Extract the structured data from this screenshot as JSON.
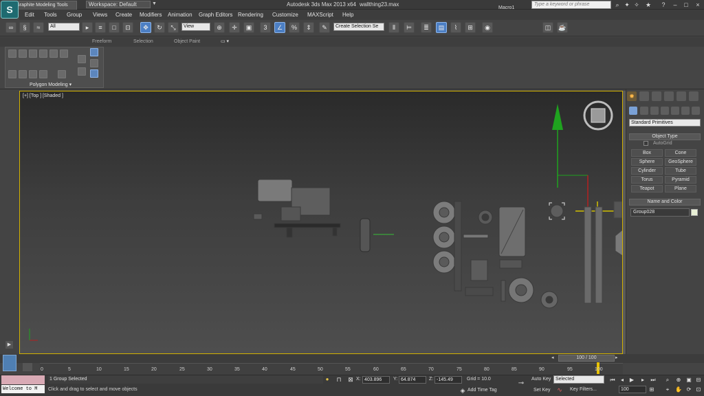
{
  "app": {
    "logo_letter": "S",
    "workspace": "Workspace: Default",
    "title": "Autodesk 3ds Max  2013 x64",
    "file": "wallthing23.max",
    "search_placeholder": "Type a keyword or phrase"
  },
  "menu": [
    "Edit",
    "Tools",
    "Group",
    "Views",
    "Create",
    "Modifiers",
    "Animation",
    "Graph Editors",
    "Rendering",
    "Customize",
    "MAXScript",
    "Help"
  ],
  "toolbar": {
    "selection_filter": "All",
    "ref_coord": "View",
    "named_selection": "Create Selection Se",
    "macro": "Macro1"
  },
  "ribbon": {
    "active_tab": "Graphite Modeling Tools",
    "tabs": [
      "Freeform",
      "Selection",
      "Object Paint"
    ],
    "panel_label": "Polygon Modeling ▾"
  },
  "viewport": {
    "label": "[+] [Top ] [Shaded ]"
  },
  "command_panel": {
    "category": "Standard Primitives",
    "object_type_title": "Object Type",
    "autogrid": "AutoGrid",
    "primitives": [
      "Box",
      "Cone",
      "Sphere",
      "GeoSphere",
      "Cylinder",
      "Tube",
      "Torus",
      "Pyramid",
      "Teapot",
      "Plane"
    ],
    "name_color_title": "Name and Color",
    "object_name": "Group028",
    "object_color": "#e9f0d6"
  },
  "timeline": {
    "slider": "100 / 100",
    "ticks": [
      "0",
      "5",
      "10",
      "15",
      "20",
      "25",
      "30",
      "35",
      "40",
      "45",
      "50",
      "55",
      "60",
      "65",
      "70",
      "75",
      "80",
      "85",
      "90",
      "95",
      "100"
    ],
    "current_frame": 100
  },
  "status": {
    "maxscript_text": "Welcome to M",
    "selection": "1 Group Selected",
    "prompt": "Click and drag to select and move objects",
    "x_label": "X:",
    "x": "403.896",
    "y_label": "Y:",
    "y": "64.874",
    "z_label": "Z:",
    "z": "-145.49",
    "grid": "Grid = 10.0",
    "add_time_tag": "Add Time Tag",
    "auto_key": "Auto Key",
    "set_key": "Set Key",
    "key_mode": "Selected",
    "key_filters": "Key Filters...",
    "frame": "100"
  },
  "colors": {
    "viewport_border": "#d3b200",
    "active_tool": "#4c7fc4",
    "axis_green": "#1fa31f",
    "axis_red": "#b42020"
  }
}
